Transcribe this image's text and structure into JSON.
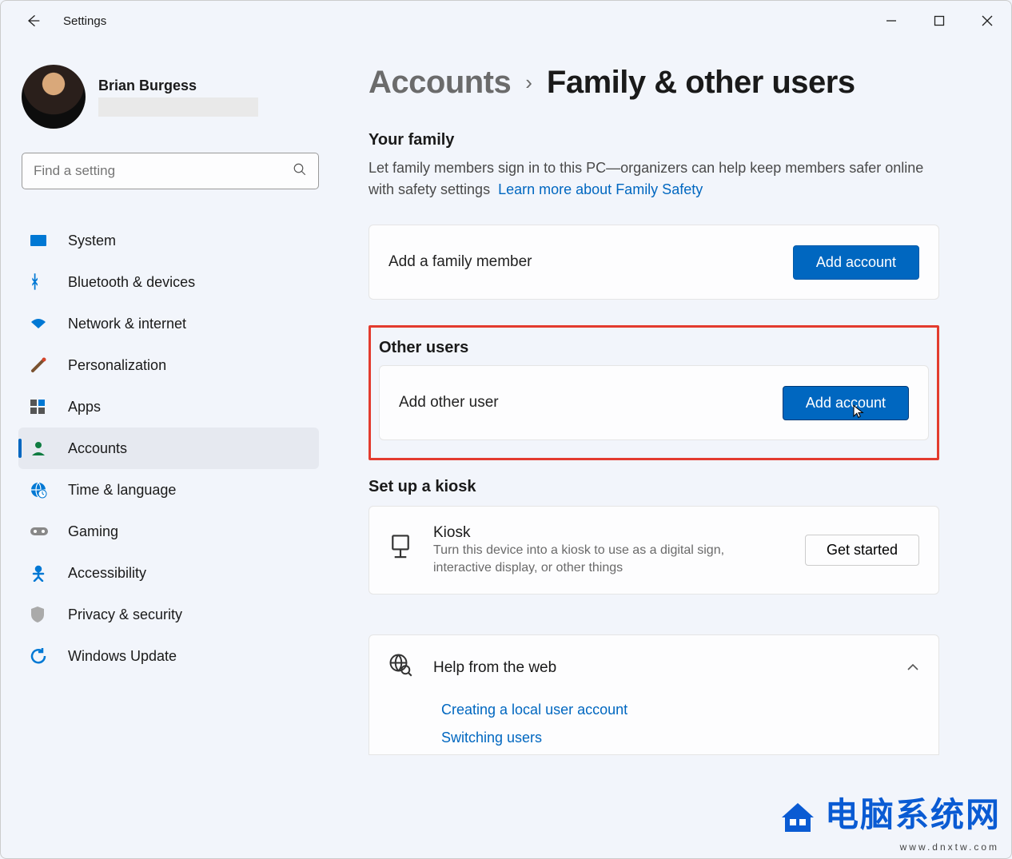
{
  "app_title": "Settings",
  "profile": {
    "name": "Brian Burgess"
  },
  "search": {
    "placeholder": "Find a setting"
  },
  "nav": {
    "items": [
      {
        "label": "System",
        "icon": "🖥️"
      },
      {
        "label": "Bluetooth & devices",
        "icon": "B"
      },
      {
        "label": "Network & internet",
        "icon": "▼"
      },
      {
        "label": "Personalization",
        "icon": "✎"
      },
      {
        "label": "Apps",
        "icon": "▦"
      },
      {
        "label": "Accounts",
        "icon": "👤"
      },
      {
        "label": "Time & language",
        "icon": "🕒"
      },
      {
        "label": "Gaming",
        "icon": "🎮"
      },
      {
        "label": "Accessibility",
        "icon": "✲"
      },
      {
        "label": "Privacy & security",
        "icon": "🛡"
      },
      {
        "label": "Windows Update",
        "icon": "⟳"
      }
    ],
    "active_index": 5
  },
  "breadcrumb": {
    "parent": "Accounts",
    "current": "Family & other users"
  },
  "family": {
    "title": "Your family",
    "desc": "Let family members sign in to this PC—organizers can help keep members safer online with safety settings",
    "link": "Learn more about Family Safety",
    "card_label": "Add a family member",
    "button": "Add account"
  },
  "other": {
    "title": "Other users",
    "card_label": "Add other user",
    "button": "Add account"
  },
  "kiosk": {
    "section_title": "Set up a kiosk",
    "title": "Kiosk",
    "desc": "Turn this device into a kiosk to use as a digital sign, interactive display, or other things",
    "button": "Get started"
  },
  "help": {
    "title": "Help from the web",
    "links": [
      "Creating a local user account",
      "Switching users"
    ]
  },
  "watermark": {
    "text": "电脑系统网",
    "sub": "www.dnxtw.com"
  }
}
